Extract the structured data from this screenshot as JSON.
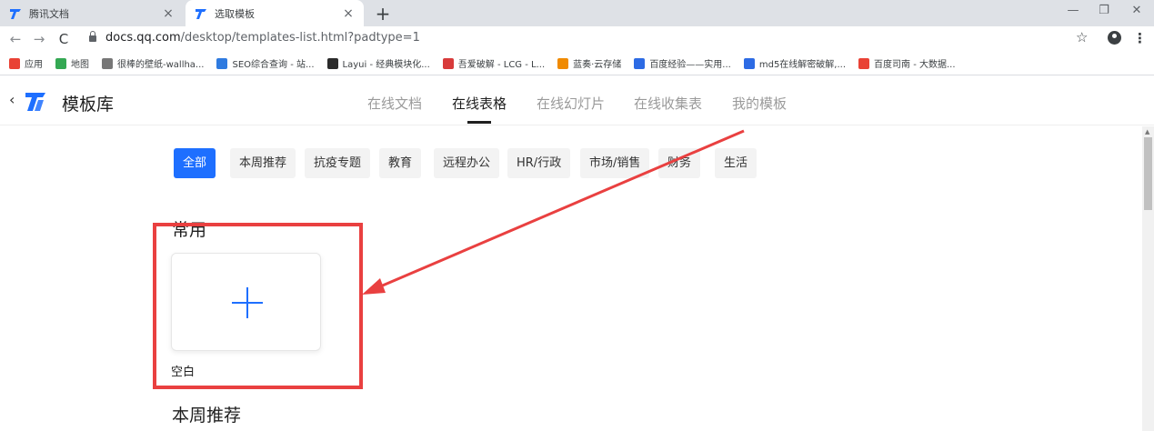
{
  "browser": {
    "tabs": [
      {
        "title": "腾讯文档",
        "close": "×"
      },
      {
        "title": "选取模板",
        "close": "×"
      }
    ],
    "new_tab": "+",
    "window_controls": {
      "minimize": "—",
      "maximize": "❐",
      "close": "✕"
    },
    "nav": {
      "back": "←",
      "forward": "→",
      "reload": "C"
    },
    "url": {
      "host": "docs.qq.com",
      "path": "/desktop/templates-list.html?padtype=1"
    },
    "star": "☆",
    "menu": "⋮"
  },
  "bookmarks": [
    {
      "label": "应用",
      "color": "#e94235"
    },
    {
      "label": "地图",
      "color": "#34a853"
    },
    {
      "label": "很棒的壁纸-wallha...",
      "color": "#777777"
    },
    {
      "label": "SEO综合查询 - 站...",
      "color": "#2f7be0"
    },
    {
      "label": "Layui - 经典模块化...",
      "color": "#2b2b2b"
    },
    {
      "label": "吾爱破解 - LCG - L...",
      "color": "#d83b3b"
    },
    {
      "label": "蓝奏·云存储",
      "color": "#f08a00"
    },
    {
      "label": "百度经验——实用...",
      "color": "#2d6be4"
    },
    {
      "label": "md5在线解密破解,...",
      "color": "#2d6be4"
    },
    {
      "label": "百度司南 - 大数据...",
      "color": "#e94235"
    }
  ],
  "header": {
    "back": "‹",
    "title": "模板库",
    "tabs": [
      {
        "label": "在线文档"
      },
      {
        "label": "在线表格"
      },
      {
        "label": "在线幻灯片"
      },
      {
        "label": "在线收集表"
      },
      {
        "label": "我的模板"
      }
    ]
  },
  "categories": [
    {
      "label": "全部"
    },
    {
      "label": "本周推荐"
    },
    {
      "label": "抗疫专题"
    },
    {
      "label": "教育"
    },
    {
      "label": "远程办公"
    },
    {
      "label": "HR/行政"
    },
    {
      "label": "市场/销售"
    },
    {
      "label": "财务"
    },
    {
      "label": "生活"
    }
  ],
  "sections": {
    "common_title": "常用",
    "blank_label": "空白",
    "weekly_title": "本周推荐"
  },
  "colors": {
    "accent": "#1e6fff",
    "annotation": "#e94040",
    "brand": "#1e6fff"
  }
}
